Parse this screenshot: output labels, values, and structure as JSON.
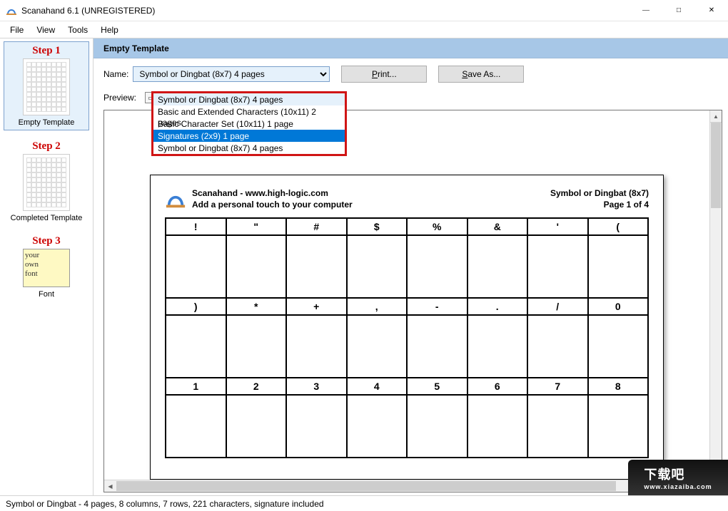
{
  "titleBar": {
    "title": "Scanahand 6.1 (UNREGISTERED)"
  },
  "menu": {
    "file": "File",
    "view": "View",
    "tools": "Tools",
    "help": "Help"
  },
  "sidebar": {
    "step1": {
      "title": "Step 1",
      "label": "Empty Template"
    },
    "step2": {
      "title": "Step 2",
      "label": "Completed Template"
    },
    "step3": {
      "title": "Step 3",
      "label": "Font",
      "thumb_line1": "your",
      "thumb_line2": "own",
      "thumb_line3": "font"
    }
  },
  "header": {
    "title": "Empty Template"
  },
  "toolbar": {
    "name_label": "Name:",
    "selected": "Symbol or Dingbat (8x7) 4 pages",
    "print": "Print...",
    "save_as": "Save As...",
    "preview_label": "Preview:"
  },
  "dropdown": {
    "opt0": "Symbol or Dingbat (8x7) 4 pages",
    "opt1": "Basic and Extended Characters (10x11) 2 pages",
    "opt2": "Basic Character Set (10x11) 1 page",
    "opt3": "Signatures (2x9) 1 page",
    "opt4": "Symbol or Dingbat (8x7) 4 pages"
  },
  "page": {
    "brand_line1": "Scanahand - www.high-logic.com",
    "brand_line2": "Add a personal touch to your computer",
    "right_line1": "Symbol or Dingbat (8x7)",
    "right_line2": "Page 1 of 4",
    "row1": {
      "c1": "!",
      "c2": "\"",
      "c3": "#",
      "c4": "$",
      "c5": "%",
      "c6": "&",
      "c7": "'",
      "c8": "("
    },
    "row2": {
      "c1": ")",
      "c2": "*",
      "c3": "+",
      "c4": ",",
      "c5": "-",
      "c6": ".",
      "c7": "/",
      "c8": "0"
    },
    "row3": {
      "c1": "1",
      "c2": "2",
      "c3": "3",
      "c4": "4",
      "c5": "5",
      "c6": "6",
      "c7": "7",
      "c8": "8"
    }
  },
  "status": {
    "text": "Symbol or Dingbat - 4 pages, 8 columns, 7 rows, 221 characters, signature included"
  },
  "watermark": {
    "text": "下载吧",
    "url": "www.xiazaiba.com"
  }
}
